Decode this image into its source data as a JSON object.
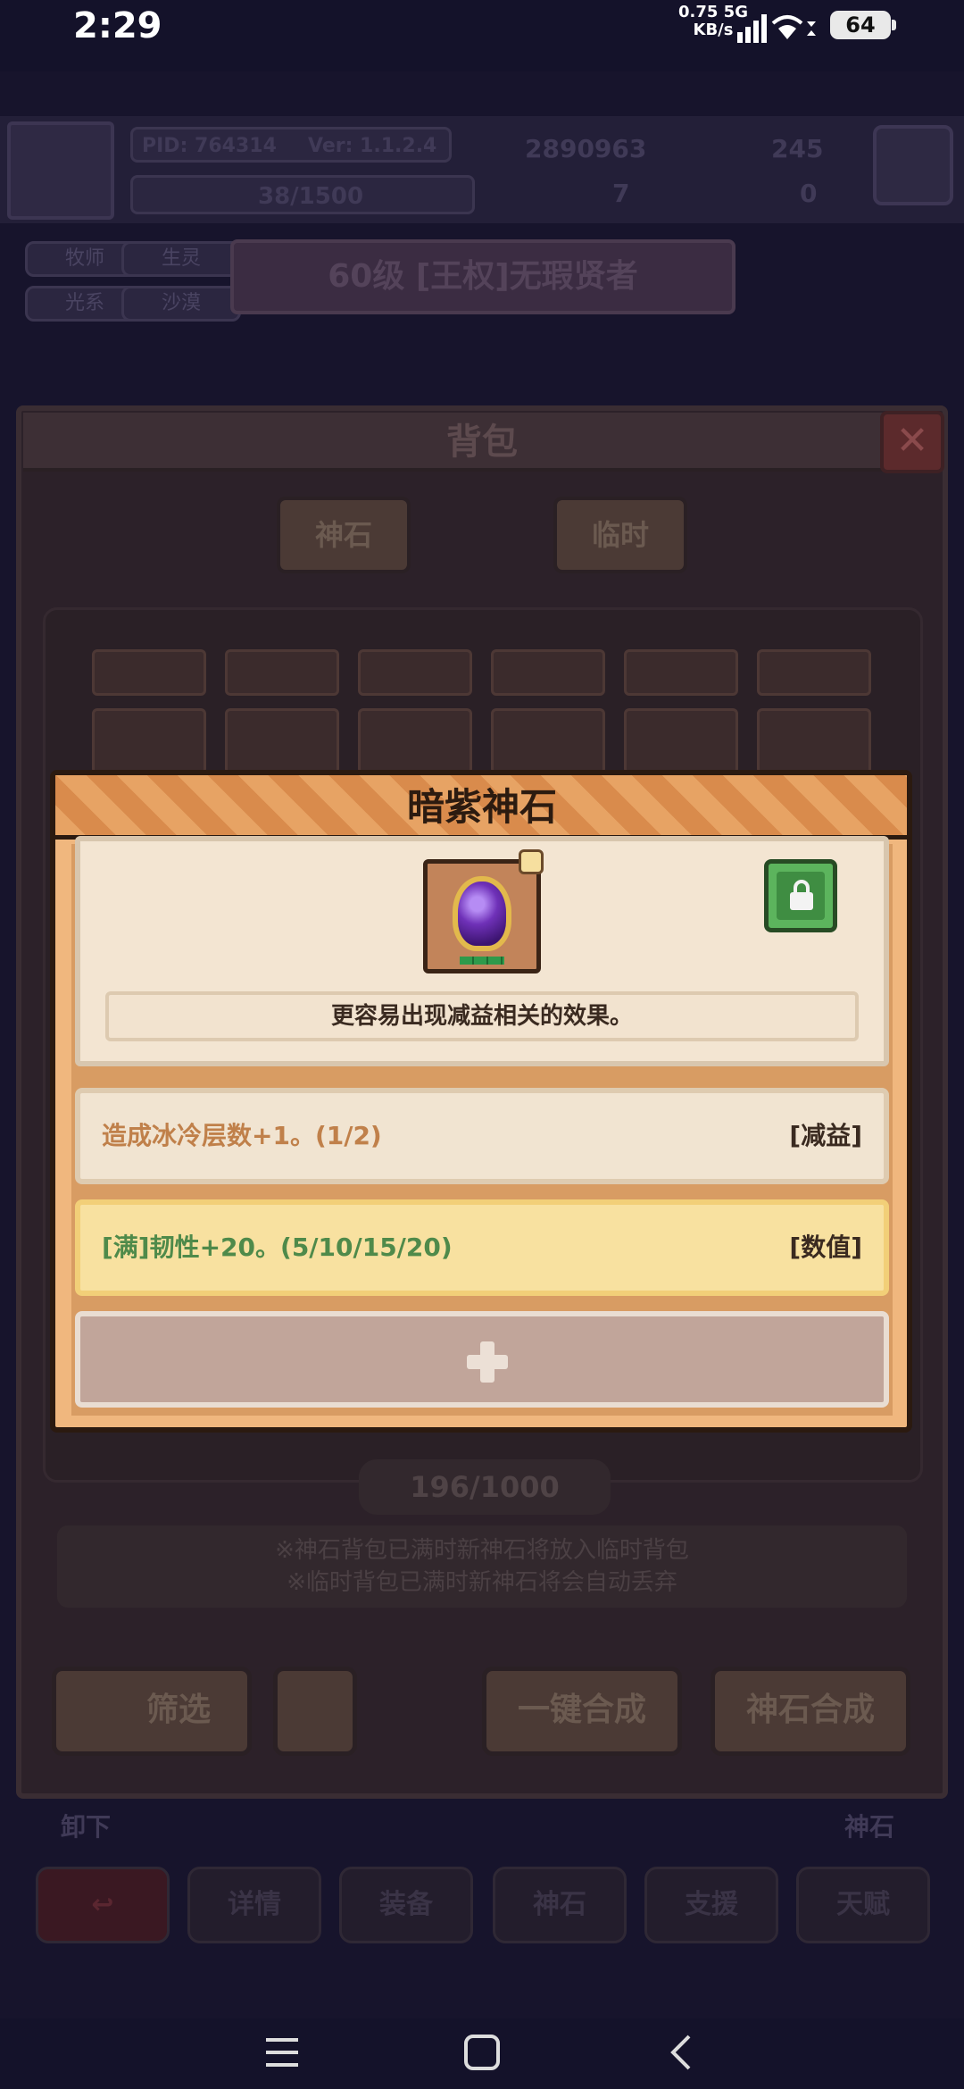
{
  "status_bar": {
    "time": "2:29",
    "speed_value": "0.75 5G",
    "speed_unit": "KB/s",
    "battery": "64"
  },
  "header": {
    "pid": "PID: 764314",
    "version": "Ver: 1.1.2.4",
    "gold": "2890963",
    "gems": "245",
    "exp": "38/1500",
    "clover": "7",
    "boots": "0",
    "tags": [
      "牧师",
      "生灵",
      "光系",
      "沙漠"
    ],
    "player_title": "60级 [王权]无瑕贤者"
  },
  "backpack": {
    "title": "背包",
    "close": "✕",
    "tabs": [
      "神石",
      "临时"
    ],
    "count": "196/1000",
    "notes": [
      "※神石背包已满时新神石将放入临时背包",
      "※临时背包已满时新神石将会自动丢弃"
    ],
    "buttons": {
      "filter": "筛选",
      "one_click_merge": "一键合成",
      "stone_merge": "神石合成"
    },
    "behind_labels": [
      "卸下",
      "神石"
    ]
  },
  "bottom_nav": [
    "↩",
    "详情",
    "装备",
    "神石",
    "支援",
    "天赋"
  ],
  "gem_detail": {
    "title": "暗紫神石",
    "description": "更容易出现减益相关的效果。",
    "effects": [
      {
        "text": "造成冰冷层数+1。(1/2)",
        "tag": "[减益]",
        "color": "#c0804a"
      },
      {
        "text": "[满]韧性+20。(5/10/15/20)",
        "tag": "[数值]",
        "color": "#4f8a4a"
      }
    ],
    "add_slot_icon": "plus-icon",
    "lock_icon": "lock-icon"
  }
}
